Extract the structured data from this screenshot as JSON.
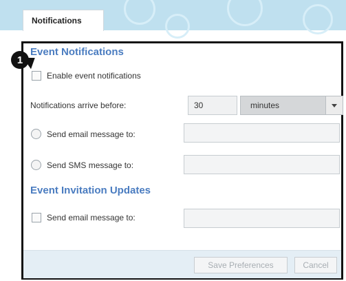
{
  "tab": {
    "label": "Notifications"
  },
  "event_notifications": {
    "title": "Event Notifications",
    "enable_label": "Enable event notifications",
    "arrive_label": "Notifications arrive before:",
    "arrive_value": "30",
    "arrive_unit": "minutes",
    "email_label": "Send email message to:",
    "email_value": "",
    "sms_label": "Send SMS message to:",
    "sms_value": ""
  },
  "invitation_updates": {
    "title": "Event Invitation Updates",
    "email_label": "Send email message to:",
    "email_value": ""
  },
  "footer": {
    "save_label": "Save Preferences",
    "cancel_label": "Cancel"
  },
  "callout": {
    "number": "1"
  },
  "colors": {
    "header_band": "#bfe0ef",
    "section_title": "#4a7cc0",
    "footer": "#e4eef5"
  }
}
